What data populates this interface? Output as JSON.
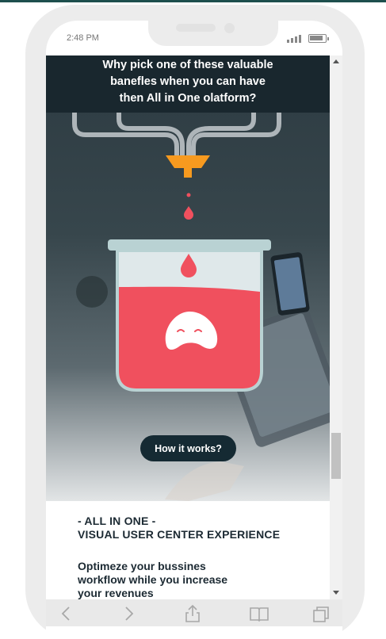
{
  "status_bar": {
    "time": "2:48 PM"
  },
  "hero": {
    "title_lines": [
      "Why pick one of these valuable",
      "banefles when you can have",
      "then All in One olatform?"
    ],
    "cta_label": "How it works?"
  },
  "content": {
    "tagline_lines": [
      "- ALL IN ONE -",
      "VISUAL USER CENTER EXPERIENCE"
    ],
    "description_lines": [
      "Optimeze your bussines",
      "workflow while you increase",
      "your revenues"
    ]
  },
  "browser_toolbar": {
    "icons": [
      "back-icon",
      "forward-icon",
      "share-icon",
      "bookmarks-icon",
      "tabs-icon"
    ]
  },
  "colors": {
    "accent_dark": "#152a33",
    "liquid_red": "#f0505e",
    "funnel_orange": "#f79a1f",
    "text_dark": "#1c2a33"
  }
}
